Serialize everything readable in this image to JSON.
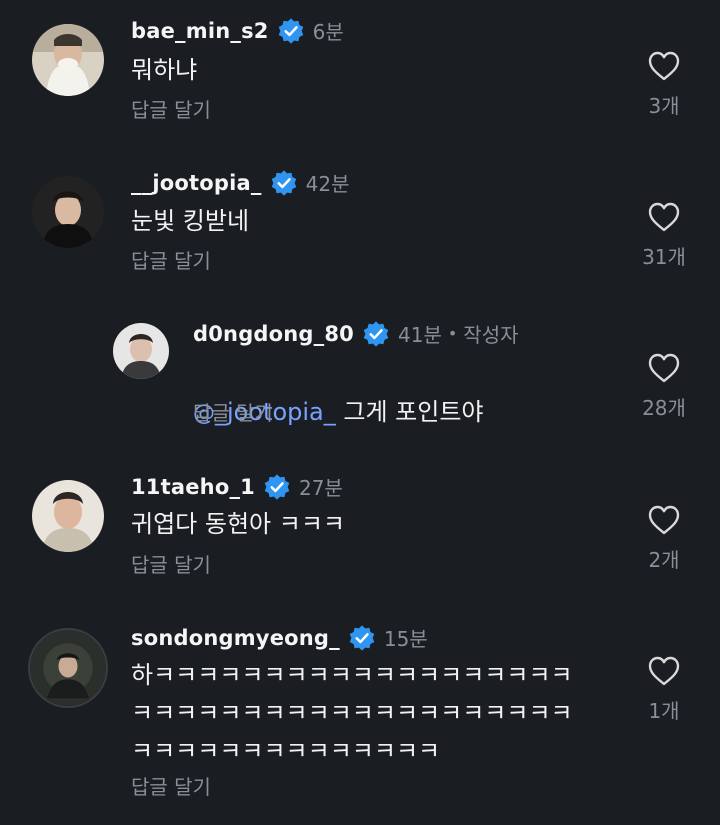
{
  "comments": [
    {
      "username": "bae_min_s2",
      "time": "6분",
      "text": "뭐하냐",
      "reply_label": "답글 달기",
      "likes": "3개",
      "verified_icon": "verified-badge-icon"
    },
    {
      "username": "__jootopia_",
      "time": "42분",
      "text": "눈빛 킹받네",
      "reply_label": "답글 달기",
      "likes": "31개",
      "verified_icon": "verified-badge-icon"
    },
    {
      "username": "d0ngdong_80",
      "time": "41분",
      "dot": "•",
      "author_tag": "작성자",
      "mention_glyph": "@",
      "mention": "_jootopia_",
      "text": " 그게 포인트야",
      "reply_label": "답글 달기",
      "likes": "28개",
      "verified_icon": "verified-badge-icon"
    },
    {
      "username": "11taeho_1",
      "time": "27분",
      "text": "귀엽다 동현아 ㅋㅋㅋ",
      "reply_label": "답글 달기",
      "likes": "2개",
      "verified_icon": "verified-badge-icon"
    },
    {
      "username": "sondongmyeong_",
      "time": "15분",
      "text": "하ㅋㅋㅋㅋㅋㅋㅋㅋㅋㅋㅋㅋㅋㅋㅋㅋㅋㅋㅋ\nㅋㅋㅋㅋㅋㅋㅋㅋㅋㅋㅋㅋㅋㅋㅋㅋㅋㅋㅋㅋ\nㅋㅋㅋㅋㅋㅋㅋㅋㅋㅋㅋㅋㅋㅋ",
      "reply_label": "답글 달기",
      "likes": "1개",
      "verified_icon": "verified-badge-icon"
    }
  ],
  "colors": {
    "background": "#1a1d22",
    "verified": "#2f95f0",
    "mention": "#7aa2ff",
    "muted": "#8a8f96"
  }
}
